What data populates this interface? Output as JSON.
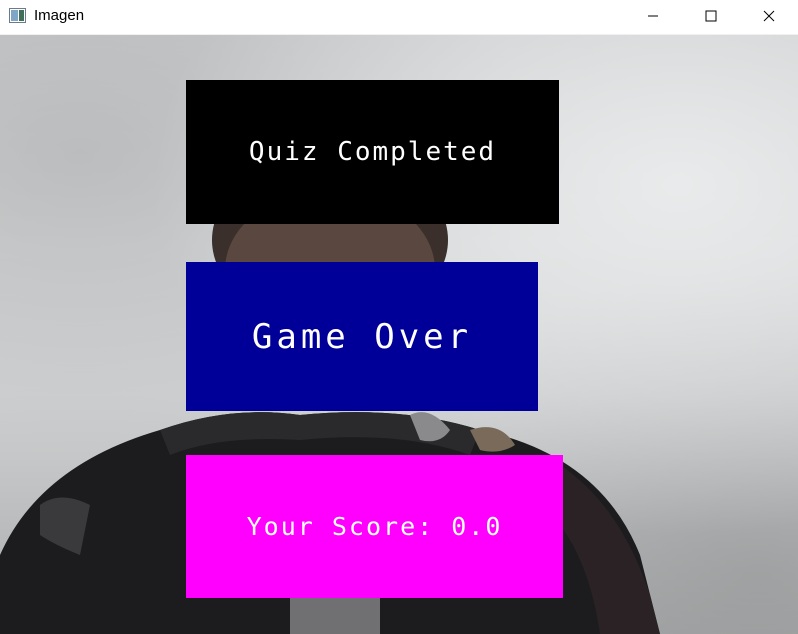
{
  "window": {
    "title": "Imagen",
    "icon": "app-window-icon",
    "controls": {
      "minimize_icon": "minimize-icon",
      "maximize_icon": "maximize-icon",
      "close_icon": "close-icon"
    }
  },
  "overlay": {
    "quiz_status": "Quiz Completed",
    "game_status": "Game Over",
    "score_text": "Your Score: 0.0"
  },
  "colors": {
    "quiz_panel": "#000000",
    "game_panel": "#000099",
    "score_panel": "#ff00ff",
    "overlay_text": "#ffffff"
  }
}
